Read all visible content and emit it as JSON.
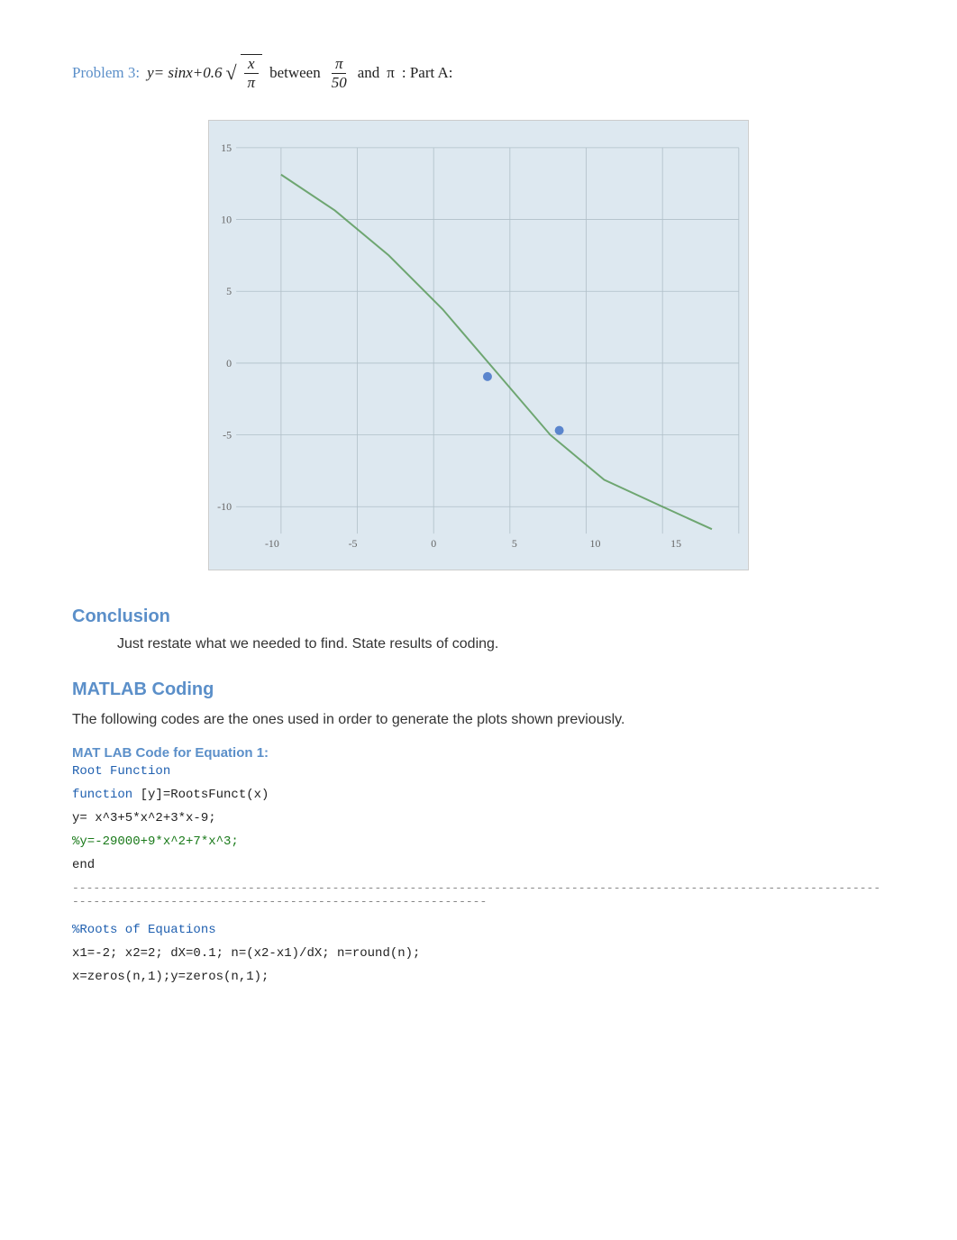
{
  "problem": {
    "label": "Problem 3:",
    "formula_prefix": "y= sinx+0.6",
    "fraction_top": "x",
    "fraction_bottom": "π",
    "between_text": "between",
    "fraction2_top": "π",
    "fraction2_bottom": "50",
    "and_text": "and",
    "pi_symbol": "π",
    "part_text": ": Part A:"
  },
  "conclusion": {
    "heading": "Conclusion",
    "body": "Just restate what we needed to find. State results of coding."
  },
  "matlab_coding": {
    "heading": "MATLAB Coding",
    "intro": "The following codes are the ones used in order to generate the plots shown previously.",
    "equation1_label": "MAT LAB Code for Equation 1:",
    "root_function_label": "Root Function",
    "function_keyword": "function",
    "function_code": "        [y]=RootsFunct(x)",
    "code_line1": "y= x^3+5*x^2+3*x-9;",
    "code_line2_green": "%y=-29000+9*x^2+7*x^3;",
    "code_end": "end",
    "divider": "------------------------------------------------------------------------------------------------------------------------------------------------------------------------------",
    "roots_label": "%Roots of Equations",
    "roots_code1": "x1=-2; x2=2; dX=0.1; n=(x2-x1)/dX; n=round(n);",
    "roots_code2": "x=zeros(n,1);y=zeros(n,1);"
  }
}
